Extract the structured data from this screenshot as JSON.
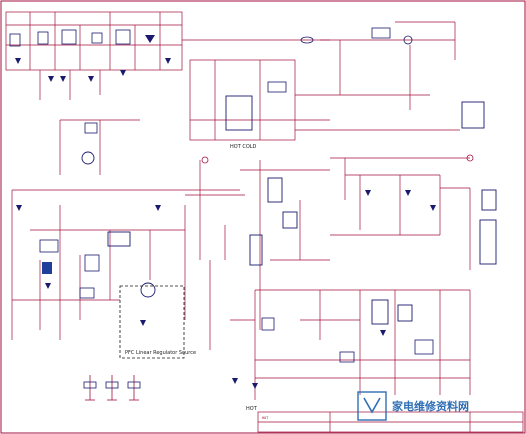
{
  "colors": {
    "wire": "#a0103c",
    "component": "#1a1a6e",
    "fill_blue": "#1f3f9a",
    "background": "#ffffff",
    "watermark": "#2e6fb5"
  },
  "labels": {
    "hot_cold": "HOT    COLD",
    "hot_bottom": "HOT",
    "linear_regulator": "PFC Linear Regulator Source",
    "title_block": "HOT",
    "watermark_text": "家电维修资料网"
  }
}
